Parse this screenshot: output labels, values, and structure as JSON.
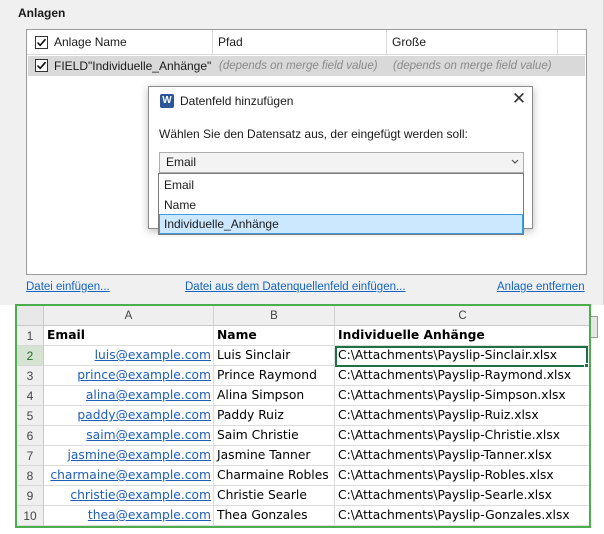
{
  "panel": {
    "title": "Anlagen",
    "columns": [
      "Anlage Name",
      "Pfad",
      "Große"
    ],
    "row": {
      "name": "FIELD\"Individuelle_Anhänge\"",
      "path": "(depends on merge field value)",
      "size": "(depends on merge field value)"
    },
    "links": {
      "insert_file": "Datei einfügen...",
      "insert_from_field": "Datei aus dem Datenquellenfeld einfügen...",
      "remove": "Anlage entfernen"
    }
  },
  "dialog": {
    "icon": "word-app-icon",
    "icon_letter": "W",
    "title": "Datenfeld hinzufügen",
    "close_glyph": "✕",
    "prompt": "Wählen Sie den Datensatz aus, der eingefügt werden soll:",
    "selected_value": "Email",
    "options": [
      "Email",
      "Name",
      "Individuelle_Anhänge"
    ],
    "highlighted_option": "Individuelle_Anhänge"
  },
  "sheet": {
    "columns": [
      "A",
      "B",
      "C"
    ],
    "headers": [
      "Email",
      "Name",
      "Individuelle Anhänge"
    ],
    "active_cell": "C2",
    "rows": [
      {
        "num": "2",
        "email": "luis@example.com",
        "name": "Luis Sinclair",
        "path": "C:\\Attachments\\Payslip-Sinclair.xlsx"
      },
      {
        "num": "3",
        "email": "prince@example.com",
        "name": "Prince Raymond",
        "path": "C:\\Attachments\\Payslip-Raymond.xlsx"
      },
      {
        "num": "4",
        "email": "alina@example.com",
        "name": "Alina Simpson",
        "path": "C:\\Attachments\\Payslip-Simpson.xlsx"
      },
      {
        "num": "5",
        "email": "paddy@example.com",
        "name": "Paddy Ruiz",
        "path": "C:\\Attachments\\Payslip-Ruiz.xlsx"
      },
      {
        "num": "6",
        "email": "saim@example.com",
        "name": "Saim Christie",
        "path": "C:\\Attachments\\Payslip-Christie.xlsx"
      },
      {
        "num": "7",
        "email": "jasmine@example.com",
        "name": "Jasmine Tanner",
        "path": "C:\\Attachments\\Payslip-Tanner.xlsx"
      },
      {
        "num": "8",
        "email": "charmaine@example.com",
        "name": "Charmaine Robles",
        "path": "C:\\Attachments\\Payslip-Robles.xlsx"
      },
      {
        "num": "9",
        "email": "christie@example.com",
        "name": "Christie Searle",
        "path": "C:\\Attachments\\Payslip-Searle.xlsx"
      },
      {
        "num": "10",
        "email": "thea@example.com",
        "name": "Thea Gonzales",
        "path": "C:\\Attachments\\Payslip-Gonzales.xlsx"
      }
    ],
    "header_row_num": "1"
  },
  "colors": {
    "link": "#1565c0",
    "sheet_border": "#4cae4c",
    "hyperlink": "#1f5fb8",
    "selection": "#cce8ff"
  }
}
